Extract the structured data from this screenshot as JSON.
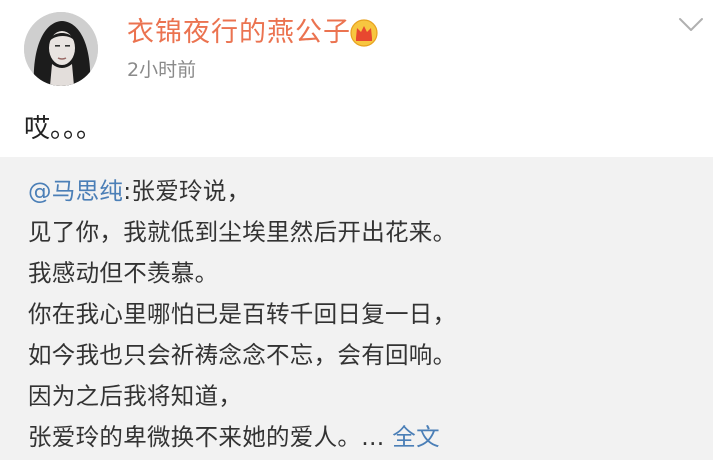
{
  "post": {
    "username": "衣锦夜行的燕公子",
    "timestamp": "2小时前",
    "text": "哎。。。",
    "badge_icon": "crown-icon",
    "menu_icon": "chevron-down-icon"
  },
  "repost": {
    "mention": "@马思纯",
    "first_line_rest": ":张爱玲说，",
    "lines": [
      "见了你，我就低到尘埃里然后开出花来。",
      "我感动但不羡慕。",
      "你在我心里哪怕已是百转千回日复一日，",
      "如今我也只会祈祷念念不忘，会有回响。",
      "因为之后我将知道，"
    ],
    "last_line": "张爱玲的卑微换不来她的爱人。",
    "ellipsis": "...",
    "more_label": "全文"
  },
  "colors": {
    "username": "#eb7350",
    "link": "#4b7fb7",
    "repost_bg": "#f2f2f2"
  }
}
